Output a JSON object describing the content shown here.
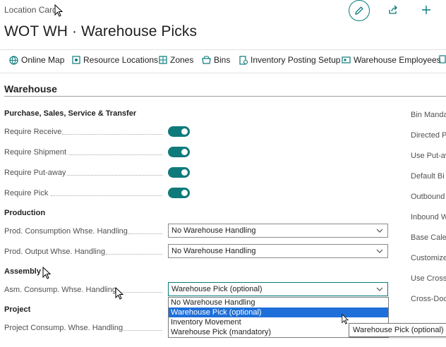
{
  "header": {
    "caption": "Location Card",
    "title": "WOT WH · Warehouse Picks"
  },
  "actions": [
    {
      "label": "Online Map",
      "icon": "map-icon"
    },
    {
      "label": "Resource Locations",
      "icon": "resource-icon"
    },
    {
      "label": "Zones",
      "icon": "zones-icon"
    },
    {
      "label": "Bins",
      "icon": "bins-icon"
    },
    {
      "label": "Inventory Posting Setup",
      "icon": "posting-setup-icon"
    },
    {
      "label": "Warehouse Employees",
      "icon": "employees-icon"
    }
  ],
  "section": {
    "title": "Warehouse"
  },
  "groups": {
    "purchase": "Purchase, Sales, Service & Transfer",
    "production": "Production",
    "assembly": "Assembly",
    "project": "Project"
  },
  "toggles": [
    {
      "label": "Require Receive",
      "on": true
    },
    {
      "label": "Require Shipment",
      "on": true
    },
    {
      "label": "Require Put-away",
      "on": true
    },
    {
      "label": "Require Pick",
      "on": true
    }
  ],
  "fields": {
    "prod_consumption": {
      "label": "Prod. Consumption Whse. Handling",
      "value": "No Warehouse Handling"
    },
    "prod_output": {
      "label": "Prod. Output Whse. Handling",
      "value": "No Warehouse Handling"
    },
    "asm_consumption": {
      "label": "Asm. Consump. Whse. Handling",
      "value": "Warehouse Pick (optional)"
    },
    "project_consumption": {
      "label": "Project Consump. Whse. Handling"
    }
  },
  "dropdown": {
    "options": [
      "No Warehouse Handling",
      "Warehouse Pick (optional)",
      "Inventory Movement",
      "Warehouse Pick (mandatory)"
    ],
    "selected_index": 1
  },
  "right_column": [
    "Bin Manda",
    "Directed P",
    "Use Put-av",
    "Default Bi",
    "Outbound",
    "Inbound W",
    "Base Calen",
    "Customize",
    "Use Cross-",
    "Cross-Doc"
  ],
  "tooltip": "Warehouse Pick (optional)",
  "colors": {
    "accent": "#0e7a7a",
    "selection": "#1e6fd9"
  }
}
